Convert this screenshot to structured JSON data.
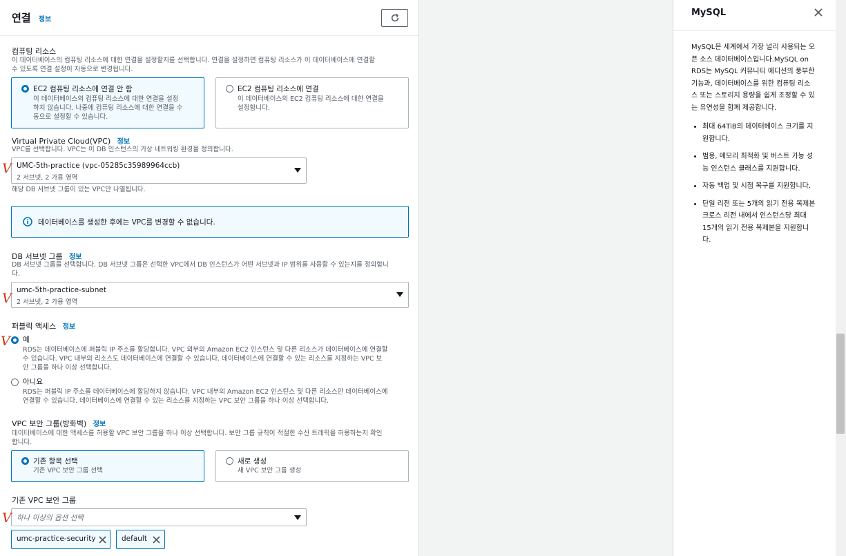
{
  "connectivity": {
    "title": "연결",
    "info": "정보",
    "compute": {
      "label": "컴퓨팅 리소스",
      "desc_line1": "이 데이터베이스의 컴퓨팅 리소스에 대한 연결을 설정할지를 선택합니다. 연결을 설정하면 컴퓨팅 리소스가 이 데이터베이스에 연결할",
      "desc_line2": "수 있도록 연결 설정이 자동으로 변경됩니다.",
      "option_no": {
        "title": "EC2 컴퓨팅 리소스에 연결 안 함",
        "desc_line1": "이 데이터베이스의 컴퓨팅 리소스에 대한 연결을 설정",
        "desc_line2": "하지 않습니다. 나중에 컴퓨팅 리소스에 대한 연결을 수",
        "desc_line3": "동으로 설정할 수 있습니다."
      },
      "option_yes": {
        "title": "EC2 컴퓨팅 리소스에 연결",
        "desc_line1": "이 데이터베이스의 EC2 컴퓨팅 리소스에 대한 연결을",
        "desc_line2": "설정합니다."
      }
    },
    "vpc": {
      "label": "Virtual Private Cloud(VPC)",
      "info": "정보",
      "desc": "VPC를 선택합니다. VPC는 이 DB 인스턴스의 가상 네트워킹 환경을 정의합니다.",
      "selected": "UMC-5th-practice (vpc-05285c35989964ccb)",
      "selected_sub": "2 서브넷, 2 가용 영역",
      "hint": "해당 DB 서브넷 그룹이 있는 VPC만 나열됩니다.",
      "alert": "데이터베이스를 생성한 후에는 VPC를 변경할 수 없습니다."
    },
    "subnet_group": {
      "label": "DB 서브넷 그룹",
      "info": "정보",
      "desc": "DB 서브넷 그룹을 선택합니다. DB 서브넷 그룹은 선택한 VPC에서 DB 인스턴스가 어떤 서브넷과 IP 범위를 사용할 수 있는지를 정의합니",
      "desc_line2": "다.",
      "selected": "umc-5th-practice-subnet",
      "selected_sub": "2 서브넷, 2 가용 영역"
    },
    "public_access": {
      "label": "퍼블릭 액세스",
      "info": "정보",
      "yes_label": "예",
      "yes_desc_line1": "RDS는 데이터베이스에 퍼블릭 IP 주소를 할당합니다. VPC 외부의 Amazon EC2 인스턴스 및 다른 리소스가 데이터베이스에 연결할",
      "yes_desc_line2": "수 있습니다. VPC 내부의 리소스도 데이터베이스에 연결할 수 있습니다. 데이터베이스에 연결할 수 있는 리소스를 지정하는 VPC 보",
      "yes_desc_line3": "안 그룹을 하나 이상 선택합니다.",
      "no_label": "아니요",
      "no_desc_line1": "RDS는 퍼블릭 IP 주소를 데이터베이스에 할당하지 않습니다. VPC 내부의 Amazon EC2 인스턴스 및 다른 리소스만 데이터베이스에",
      "no_desc_line2": "연결할 수 있습니다. 데이터베이스에 연결할 수 있는 리소스를 지정하는 VPC 보안 그룹을 하나 이상 선택합니다."
    },
    "security_group": {
      "label": "VPC 보안 그룹(방화벽)",
      "info": "정보",
      "desc_line1": "데이터베이스에 대한 액세스를 허용할 VPC 보안 그룹을 하나 이상 선택합니다. 보안 그룹 규칙이 적절한 수신 트래픽을 허용하는지 확인",
      "desc_line2": "합니다.",
      "existing_title": "기존 항목 선택",
      "existing_desc": "기존 VPC 보안 그룹 선택",
      "new_title": "새로 생성",
      "new_desc": "새 VPC 보안 그룹 생성",
      "existing_label": "기존 VPC 보안 그룹",
      "placeholder": "하나 이상의 옵션 선택",
      "tokens": [
        "umc-practice-security",
        "default"
      ]
    }
  },
  "help_panel": {
    "title": "MySQL",
    "body": "MySQL은 세계에서 가장 널리 사용되는 오픈 소스 데이터베이스입니다.MySQL on RDS는 MySQL 커뮤니티 에디션의 풍부한 기능과, 데이터베이스를 위한 컴퓨팅 리소스 또는 스토리지 용량을 쉽게 조정할 수 있는 유연성을 함께 제공합니다.",
    "bullets": [
      "최대 64TiB의 데이터베이스 크기를 지원합니다.",
      "범용, 메모리 최적화 및 버스트 가능 성능 인스턴스 클래스를 지원합니다.",
      "자동 백업 및 시점 복구를 지원합니다.",
      "단일 리전 또는 5개의 읽기 전용 복제본 크로스 리전 내에서 인스턴스당 최대 15개의 읽기 전용 복제본을 지원합니다."
    ]
  },
  "annotations": {
    "mark": "V"
  },
  "colors": {
    "accent": "#0073bb",
    "annotation": "#d13212"
  }
}
